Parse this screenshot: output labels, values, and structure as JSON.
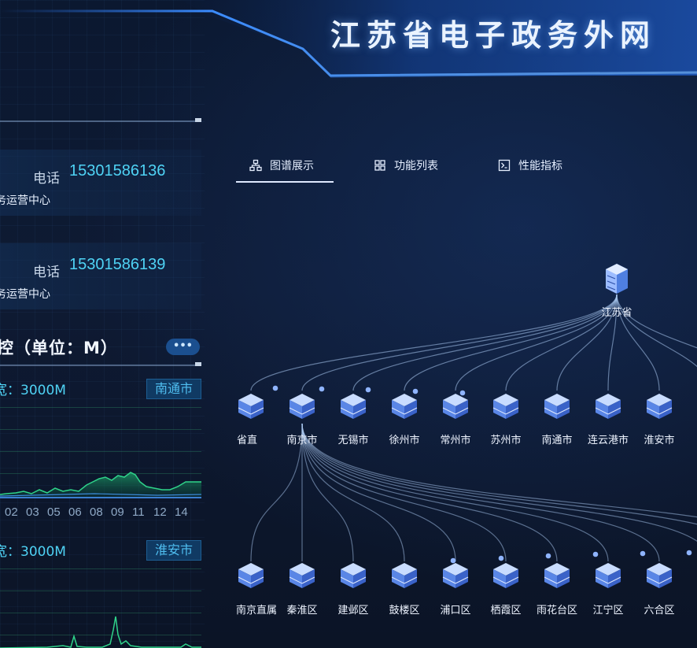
{
  "header": {
    "title": "江苏省电子政务外网"
  },
  "contacts": [
    {
      "phone_label": "电话",
      "phone": "15301586136",
      "org": "务运营中心"
    },
    {
      "phone_label": "电话",
      "phone": "15301586139",
      "org": "务运营中心"
    }
  ],
  "monitor": {
    "title": "控（单位：M）",
    "more_label": "•••",
    "panels": [
      {
        "bandwidth": "宽：3000M",
        "city": "南通市",
        "x_ticks": [
          "02",
          "03",
          "05",
          "06",
          "08",
          "09",
          "11",
          "12",
          "14"
        ]
      },
      {
        "bandwidth": "宽：3000M",
        "city": "淮安市"
      }
    ]
  },
  "tabs": [
    {
      "label": "图谱展示",
      "icon": "hierarchy-icon",
      "active": true
    },
    {
      "label": "功能列表",
      "icon": "grid-icon",
      "active": false
    },
    {
      "label": "性能指标",
      "icon": "terminal-icon",
      "active": false
    }
  ],
  "graph": {
    "root": {
      "label": "江苏省"
    },
    "level1": [
      "省直",
      "南京市",
      "无锡市",
      "徐州市",
      "常州市",
      "苏州市",
      "南通市",
      "连云港市",
      "淮安市"
    ],
    "level2": [
      "南京直属",
      "秦淮区",
      "建邺区",
      "鼓楼区",
      "浦口区",
      "栖霞区",
      "雨花台区",
      "江宁区",
      "六合区"
    ]
  },
  "colors": {
    "accent": "#4fd3f5",
    "background": "#0c1628",
    "node": "#4a73d8"
  }
}
